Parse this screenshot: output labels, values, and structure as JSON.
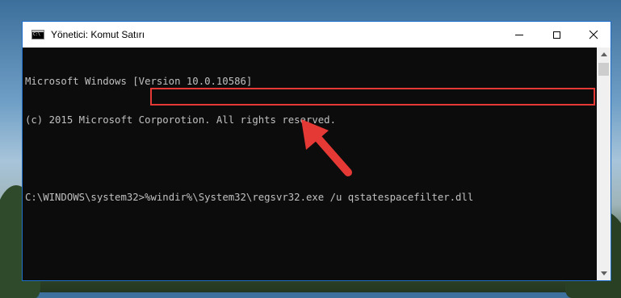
{
  "window": {
    "title": "Yönetici: Komut Satırı",
    "icon": "cmd-icon"
  },
  "controls": {
    "minimize": "minimize-icon",
    "maximize": "maximize-icon",
    "close": "close-icon"
  },
  "console": {
    "lines": [
      "Microsoft Windows [Version 10.0.10586]",
      "(c) 2015 Microsoft Corporotion. All rights reserved.",
      ""
    ],
    "prompt": "C:\\WINDOWS\\system32>",
    "command": "%windir%\\System32\\regsvr32.exe /u qstatespacefilter.dll"
  },
  "colors": {
    "console_bg": "#0c0c0c",
    "console_text": "#c0c0c0",
    "highlight": "#e53935",
    "window_border": "#1e6fc9"
  }
}
